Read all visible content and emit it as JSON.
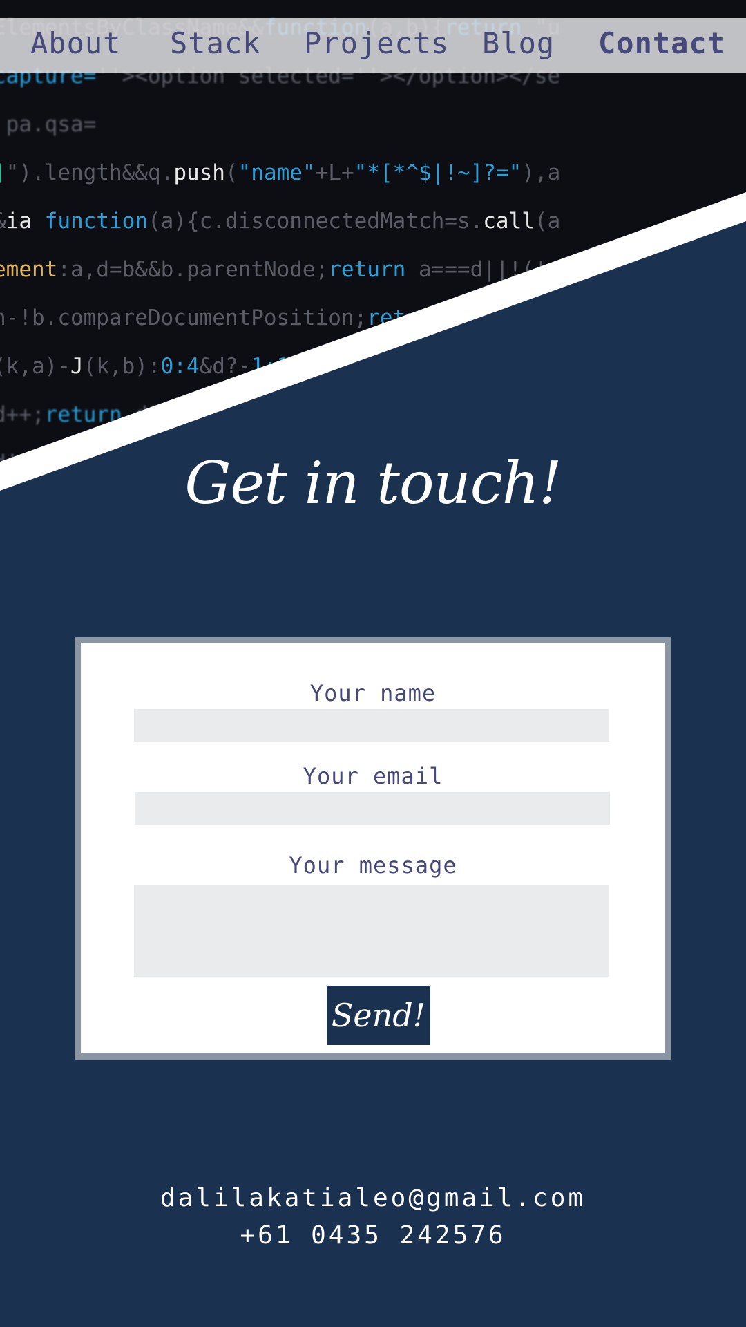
{
  "nav": {
    "items": [
      {
        "label": "About"
      },
      {
        "label": "Stack"
      },
      {
        "label": "Projects"
      },
      {
        "label": "Blog"
      },
      {
        "label": "Contact",
        "active": true
      }
    ]
  },
  "hero": {
    "title": "Get in touch!"
  },
  "form": {
    "name_label": "Your name",
    "name_value": "",
    "email_label": "Your email",
    "email_value": "",
    "message_label": "Your message",
    "message_value": "",
    "send_label": "Send!"
  },
  "contact": {
    "email": "dalilakatialeo@gmail.com",
    "phone": "+61 0435 242576"
  },
  "colors": {
    "navy": "#1b3150",
    "nav_text": "#46497a",
    "card_border": "#8a96a3",
    "field_bg": "#eaebed"
  }
}
